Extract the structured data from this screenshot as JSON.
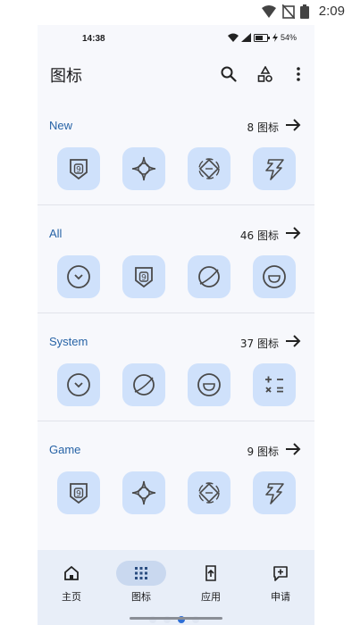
{
  "device_status": {
    "time": "2:09"
  },
  "app_status": {
    "time": "14:38",
    "battery": "54%"
  },
  "header": {
    "title": "图标"
  },
  "sections": [
    {
      "name": "New",
      "count": "8 图标",
      "icons": [
        "shield-9-icon",
        "compass-star-icon",
        "target-diamond-icon",
        "bolt-seven-icon"
      ]
    },
    {
      "name": "All",
      "count": "46 图标",
      "icons": [
        "clock-chevron-icon",
        "shield-9-icon",
        "planet-icon",
        "smile-icon"
      ]
    },
    {
      "name": "System",
      "count": "37 图标",
      "icons": [
        "clock-chevron-icon",
        "planet-icon",
        "smile-icon",
        "calculator-icon"
      ]
    },
    {
      "name": "Game",
      "count": "9 图标",
      "icons": [
        "shield-9-icon",
        "compass-star-icon",
        "target-diamond-icon",
        "bolt-seven-icon"
      ]
    }
  ],
  "nav": [
    {
      "label": "主页",
      "icon": "home-icon"
    },
    {
      "label": "图标",
      "icon": "grid-icon",
      "active": true
    },
    {
      "label": "应用",
      "icon": "app-upload-icon"
    },
    {
      "label": "申请",
      "icon": "request-add-icon"
    }
  ],
  "colors": {
    "accent": "#2763a6",
    "tile": "#cfe1fb",
    "nav_bg": "#e8eef8",
    "active_pill": "#c9d8ef"
  }
}
